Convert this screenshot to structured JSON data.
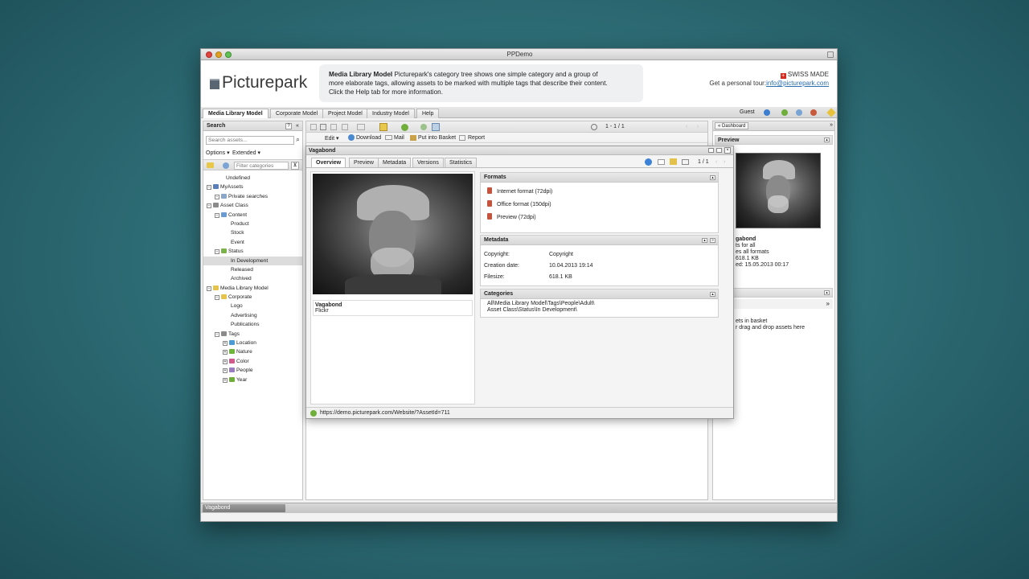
{
  "window": {
    "title": "PPDemo"
  },
  "header": {
    "logo_text": "Picturepark",
    "banner_title": "Media Library Model",
    "banner_line1": " Picturepark's category tree shows one simple category and a group of",
    "banner_line2": "more elaborate tags, allowing assets to be marked with multiple tags that describe their content.",
    "banner_line3": "Click the Help tab for more information.",
    "swiss": "SWISS MADE",
    "tour_label": "Get a personal tour:",
    "tour_email": "info@picturepark.com"
  },
  "tabs": [
    "Media Library Model",
    "Corporate Model",
    "Project Model",
    "Industry Model",
    "Help"
  ],
  "user": {
    "name": "Guest"
  },
  "search": {
    "title": "Search",
    "placeholder": "Search assets...",
    "options": "Options",
    "extended": "Extended",
    "filter_placeholder": "Filter categories"
  },
  "tree": [
    {
      "label": "Undefined",
      "indent": 1,
      "icon": "none"
    },
    {
      "label": "MyAssets",
      "indent": 0,
      "icon": "user"
    },
    {
      "label": "Private searches",
      "indent": 1,
      "icon": "search"
    },
    {
      "label": "Asset Class",
      "indent": 0,
      "icon": "tag"
    },
    {
      "label": "Content",
      "indent": 1,
      "icon": "globe"
    },
    {
      "label": "Product",
      "indent": 2,
      "icon": "none"
    },
    {
      "label": "Stock",
      "indent": 2,
      "icon": "none"
    },
    {
      "label": "Event",
      "indent": 2,
      "icon": "none"
    },
    {
      "label": "Status",
      "indent": 1,
      "icon": "status"
    },
    {
      "label": "In Development",
      "indent": 2,
      "icon": "none",
      "selected": true
    },
    {
      "label": "Released",
      "indent": 2,
      "icon": "none"
    },
    {
      "label": "Archived",
      "indent": 2,
      "icon": "none"
    },
    {
      "label": "Media Library Model",
      "indent": 0,
      "icon": "folder"
    },
    {
      "label": "Corporate",
      "indent": 1,
      "icon": "folder"
    },
    {
      "label": "Logo",
      "indent": 2,
      "icon": "none"
    },
    {
      "label": "Advertising",
      "indent": 2,
      "icon": "none"
    },
    {
      "label": "Publications",
      "indent": 2,
      "icon": "none"
    },
    {
      "label": "Tags",
      "indent": 1,
      "icon": "tag"
    },
    {
      "label": "Location",
      "indent": 2,
      "icon": "location"
    },
    {
      "label": "Nature",
      "indent": 2,
      "icon": "nature"
    },
    {
      "label": "Color",
      "indent": 2,
      "icon": "color"
    },
    {
      "label": "People",
      "indent": 2,
      "icon": "people"
    },
    {
      "label": "Year",
      "indent": 2,
      "icon": "year"
    }
  ],
  "toolbar": {
    "page_count": "1 - 1 / 1",
    "edit": "Edit",
    "download": "Download",
    "mail": "Mail",
    "basket": "Put into Basket",
    "report": "Report"
  },
  "dialog": {
    "title": "Vagabond",
    "tabs": [
      "Overview",
      "Preview",
      "Metadata",
      "Versions",
      "Statistics"
    ],
    "page": "1 / 1",
    "asset_title": "Vagabond",
    "asset_source": "Flickr",
    "formats_title": "Formats",
    "formats": [
      "Internet format (72dpi)",
      "Office format (150dpi)",
      "Preview (72dpi)"
    ],
    "metadata_title": "Metadata",
    "metadata": [
      {
        "key": "Copyright:",
        "value": "Copyright"
      },
      {
        "key": "Creation date:",
        "value": "10.04.2013 19:14"
      },
      {
        "key": "Filesize:",
        "value": "618.1 KB"
      }
    ],
    "categories_title": "Categories",
    "categories": [
      "All\\Media Library Model\\Tags\\People\\Adult\\",
      "Asset Class\\Status\\In Development\\"
    ],
    "url": "https://demo.picturepark.com/Website/?AssetId=711"
  },
  "right_panel": {
    "dashboard": "Dashboard",
    "preview_title": "Preview",
    "name": "gabond",
    "line1": "ts for all",
    "line2": "es all formats",
    "line3": "618.1 KB",
    "line4": "ed: 15.05.2013 00:17",
    "basket_line1": "ets in basket",
    "basket_line2": "r drag and drop assets here"
  },
  "status": {
    "item": "Vagabond"
  }
}
